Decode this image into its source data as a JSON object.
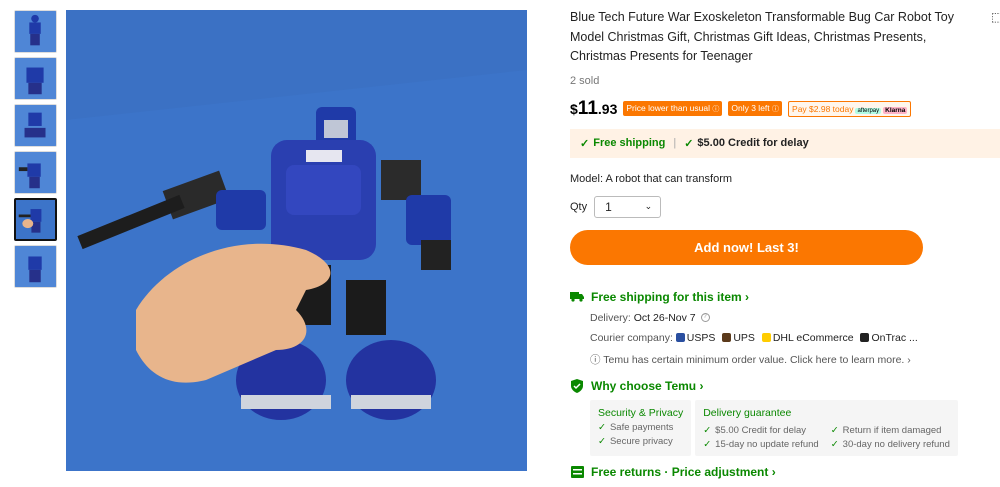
{
  "product": {
    "title": "Blue Tech Future War Exoskeleton Transformable Bug Car Robot Toy Model Christmas Gift, Christmas Gift Ideas, Christmas Presents, Christmas Presents for Teenager",
    "sold": "2 sold",
    "price": {
      "currency": "$",
      "integer": "11",
      "decimal": ".93"
    },
    "badges": {
      "price_lower": "Price lower than usual",
      "only_left": "Only 3 left",
      "pay_today": "Pay $2.98 today",
      "afterpay": "afterpay",
      "klarna": "Klarna"
    },
    "shipping_bar": {
      "free_shipping": "Free shipping",
      "separator": "|",
      "credit": "$5.00 Credit for delay"
    },
    "model": "Model: A robot that can transform",
    "qty": {
      "label": "Qty",
      "value": "1"
    },
    "add_button": "Add now! Last 3!",
    "free_shipping_item": {
      "heading": "Free shipping for this item",
      "delivery_label": "Delivery: ",
      "delivery_value": "Oct 26-Nov 7",
      "courier_label": "Courier company: ",
      "couriers": [
        "USPS",
        "UPS",
        "DHL eCommerce",
        "OnTrac ..."
      ],
      "note": "Temu has certain minimum order value. Click here to learn more."
    },
    "why_choose": {
      "heading": "Why choose Temu",
      "security": {
        "title": "Security & Privacy",
        "items": [
          "Safe payments",
          "Secure privacy"
        ]
      },
      "delivery": {
        "title": "Delivery guarantee",
        "items": [
          "$5.00 Credit for delay",
          "Return if item damaged",
          "15-day no update refund",
          "30-day no delivery refund"
        ]
      }
    },
    "returns": "Free returns · Price adjustment"
  },
  "colors": {
    "accent": "#fb7701",
    "green": "#0a8800",
    "product_blue": "#1f3aa8",
    "background_blue": "#3c74c9"
  },
  "icons": {
    "thumbnails": 6,
    "active_thumbnail": 5
  }
}
